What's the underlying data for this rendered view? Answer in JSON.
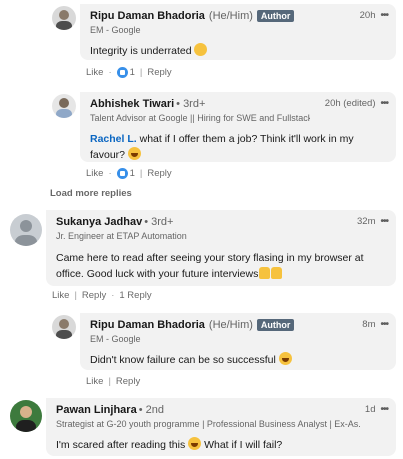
{
  "comments": [
    {
      "name": "Ripu Daman Bhadoria",
      "pronouns": "(He/Him)",
      "badge": "Author",
      "headline": "EM - Google",
      "time": "20h",
      "text": "Integrity is underrated",
      "like": "Like",
      "like_count": "1",
      "reply": "Reply"
    },
    {
      "name": "Abhishek Tiwari",
      "degree": "• 3rd+",
      "headline": "Talent Advisor at Google || Hiring for SWE and Fullstack || SFC & Si...",
      "time": "20h (edited)",
      "mention": "Rachel L.",
      "text": " what if I offer them a job? Think it'll work in my favour?",
      "like": "Like",
      "like_count": "1",
      "reply": "Reply"
    },
    {
      "load_more": "Load more replies"
    },
    {
      "name": "Sukanya Jadhav",
      "degree": "• 3rd+",
      "headline": "Jr. Engineer at ETAP Automation",
      "time": "32m",
      "text": "Came here to read after seeing your story flasing in my browser at office. Good luck with your future interviews",
      "like": "Like",
      "reply": "Reply",
      "reply_count": "1 Reply"
    },
    {
      "name": "Ripu Daman Bhadoria",
      "pronouns": "(He/Him)",
      "badge": "Author",
      "headline": "EM - Google",
      "time": "8m",
      "text": "Didn't know failure can be so successful",
      "like": "Like",
      "reply": "Reply"
    },
    {
      "name": "Pawan Linjhara",
      "degree": "• 2nd",
      "headline": "Strategist at G-20 youth programme | Professional Business Analyst | Ex-As...",
      "time": "1d",
      "text": "I'm scared after reading this",
      "text2": " What if I will fail?"
    }
  ],
  "colors": {
    "link": "#0a66c2",
    "bubble": "#f2f2f2",
    "badge": "#56687a"
  },
  "icons": [
    "like-reaction-icon",
    "more-options-icon",
    "emoji-icon",
    "thumbs-up-icon"
  ]
}
